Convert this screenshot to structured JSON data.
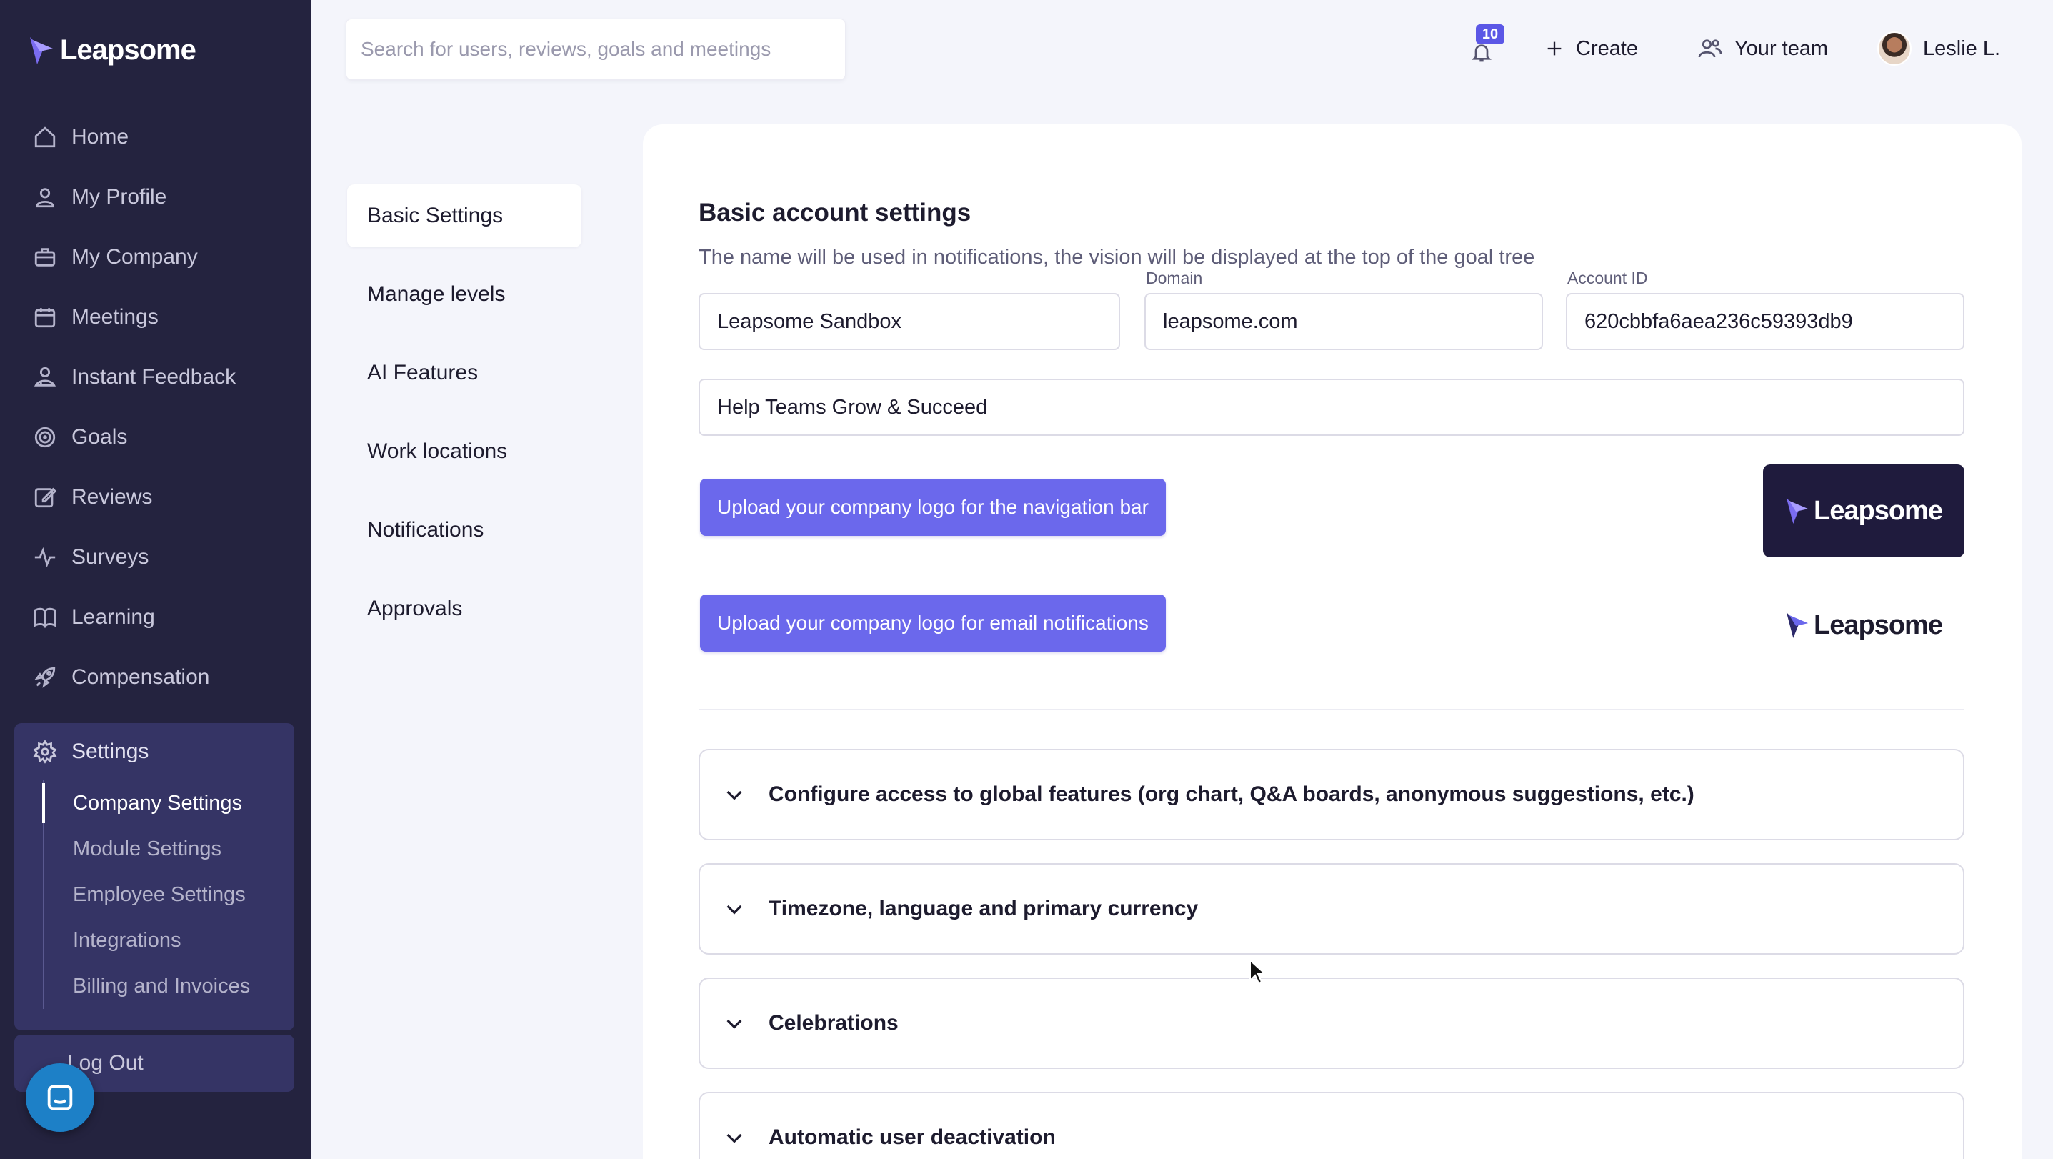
{
  "app": {
    "logo_text": "Leapsome"
  },
  "sidebar": {
    "items": [
      {
        "label": "Home",
        "icon": "home-icon"
      },
      {
        "label": "My Profile",
        "icon": "user-icon"
      },
      {
        "label": "My Company",
        "icon": "briefcase-icon"
      },
      {
        "label": "Meetings",
        "icon": "calendar-icon"
      },
      {
        "label": "Instant Feedback",
        "icon": "feedback-icon"
      },
      {
        "label": "Goals",
        "icon": "target-icon"
      },
      {
        "label": "Reviews",
        "icon": "edit-icon"
      },
      {
        "label": "Surveys",
        "icon": "pulse-icon"
      },
      {
        "label": "Learning",
        "icon": "book-icon"
      },
      {
        "label": "Compensation",
        "icon": "rocket-icon"
      }
    ],
    "settings": {
      "label": "Settings",
      "icon": "gear-icon",
      "sub_items": [
        {
          "label": "Company Settings",
          "active": true
        },
        {
          "label": "Module Settings"
        },
        {
          "label": "Employee Settings"
        },
        {
          "label": "Integrations"
        },
        {
          "label": "Billing and Invoices"
        }
      ]
    },
    "logout_label": "Log Out"
  },
  "topbar": {
    "search_placeholder": "Search for users, reviews, goals and meetings",
    "notifications_count": "10",
    "create_label": "Create",
    "team_label": "Your team",
    "user_name": "Leslie L."
  },
  "subnav": {
    "items": [
      {
        "label": "Basic Settings",
        "active": true
      },
      {
        "label": "Manage levels"
      },
      {
        "label": "AI Features"
      },
      {
        "label": "Work locations"
      },
      {
        "label": "Notifications"
      },
      {
        "label": "Approvals"
      }
    ]
  },
  "main": {
    "title": "Basic account settings",
    "description": "The name will be used in notifications, the vision will be displayed at the top of the goal tree",
    "fields": {
      "name_value": "Leapsome Sandbox",
      "domain_label": "Domain",
      "domain_value": "leapsome.com",
      "account_id_label": "Account ID",
      "account_id_value": "620cbbfa6aea236c59393db9",
      "vision_value": "Help Teams Grow & Succeed"
    },
    "upload_nav_label": "Upload your company logo for the navigation bar",
    "upload_email_label": "Upload your company logo for email notifications",
    "accordions": [
      {
        "label": "Configure access to global features (org chart, Q&A boards, anonymous suggestions, etc.)"
      },
      {
        "label": "Timezone, language and primary currency"
      },
      {
        "label": "Celebrations"
      },
      {
        "label": "Automatic user deactivation"
      }
    ]
  },
  "colors": {
    "sidebar_bg": "#24233f",
    "sidebar_active_bg": "#353465",
    "accent": "#6b68ec",
    "badge": "#5b57e6",
    "page_bg": "#f4f5fb"
  }
}
